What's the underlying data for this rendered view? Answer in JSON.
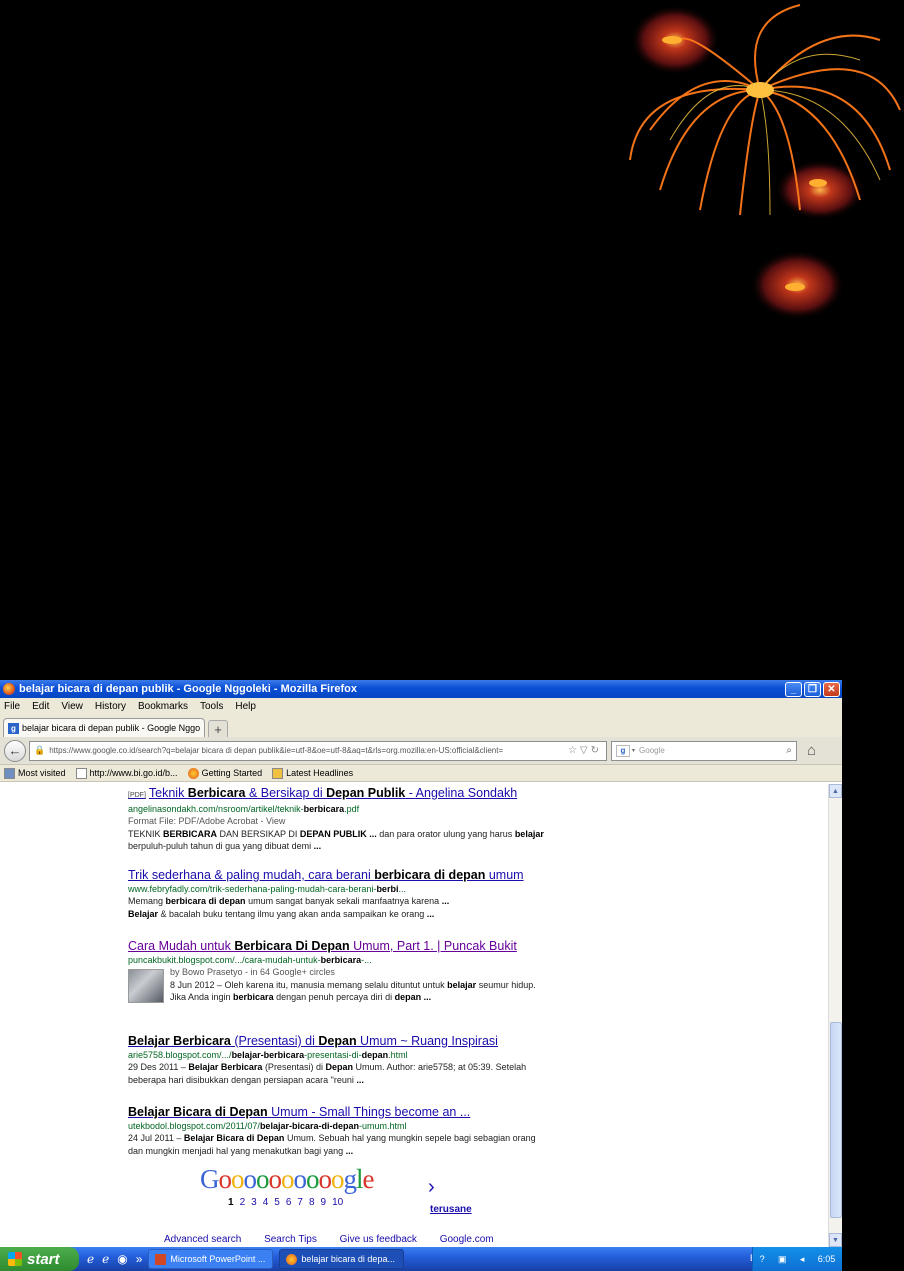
{
  "window": {
    "title": "belajar bicara di depan publik - Google Nggoleki - Mozilla Firefox"
  },
  "menu": [
    "File",
    "Edit",
    "View",
    "History",
    "Bookmarks",
    "Tools",
    "Help"
  ],
  "tab": {
    "label": "belajar bicara di depan publik - Google Nggol...",
    "new_tab": "+"
  },
  "nav": {
    "url": "https://www.google.co.id/search?q=belajar bicara di depan publik&ie=utf-8&oe=utf-8&aq=t&rls=org.mozilla:en-US:official&client=",
    "search_placeholder": "Google"
  },
  "bookmarks": [
    "Most visited",
    "http://www.bi.go.id/b...",
    "Getting Started",
    "Latest Headlines"
  ],
  "results": [
    {
      "pdf": "[PDF]",
      "title_html": "Teknik <b>Berbicara</b> &amp; Bersikap di <b>Depan Publik</b> - Angelina Sondakh",
      "url_html": "angelinasondakh.com/nsroom/artikel/teknik-<b>berbicara</b>.pdf",
      "meta": "Format File: PDF/Adobe Acrobat - View",
      "snippet_html": "TEKNIK <b>BERBICARA</b> DAN BERSIKAP DI <b>DEPAN PUBLIK ...</b> dan para orator ulung yang harus <b>belajar</b> berpuluh-puluh tahun di gua yang dibuat demi <b>...</b>"
    },
    {
      "title_html": "Trik sederhana &amp; paling mudah, cara berani <b>berbicara di depan</b> umum",
      "url_html": "www.febryfadly.com/trik-sederhana-paling-mudah-cara-berani-<b>berbi</b>...",
      "snippet_html": "Memang <b>berbicara di depan</b> umum sangat banyak sekali manfaatnya karena <b>...</b><br><b>Belajar</b> &amp; bacalah buku tentang ilmu yang akan anda sampaikan ke orang <b>...</b>"
    },
    {
      "title_html": "Cara Mudah untuk <b>Berbicara Di Depan</b> Umum, Part 1. | Puncak Bukit",
      "url_html": "puncakbukit.blogspot.com/.../cara-mudah-untuk-<b>berbicara</b>-...",
      "meta": "by Bowo Prasetyo - in 64 Google+ circles",
      "snippet_html": "8 Jun 2012 – Oleh karena itu, manusia memang selalu dituntut untuk <b>belajar</b> seumur hidup. Jika Anda ingin <b>berbicara</b> dengan penuh percaya diri di <b>depan ...</b>"
    },
    {
      "title_html": "<b>Belajar Berbicara</b> (Presentasi) di <b>Depan</b> Umum ~ Ruang Inspirasi",
      "url_html": "arie5758.blogspot.com/.../<b>belajar-berbicara</b>-presentasi-di-<b>depan</b>.html",
      "snippet_html": "29 Des 2011 – <b>Belajar Berbicara</b> (Presentasi) di <b>Depan</b> Umum. Author: arie5758; at 05:39. Setelah beberapa hari disibukkan dengan persiapan acara \"reuni <b>...</b>"
    },
    {
      "title_html": "<b>Belajar Bicara di Depan</b> Umum - Small Things become an ...",
      "url_html": "utekbodol.blogspot.com/2011/07/<b>belajar-bicara-di-depan</b>-umum.html",
      "snippet_html": "24 Jul 2011 – <b>Belajar Bicara di Depan</b> Umum. Sebuah hal yang mungkin sepele bagi sebagian orang dan mungkin menjadi hal yang menakutkan bagi yang <b>...</b>"
    }
  ],
  "pager": {
    "logo_letters": [
      "G",
      "o",
      "o",
      "o",
      "o",
      "o",
      "o",
      "o",
      "o",
      "o",
      "o",
      "g",
      "l",
      "e"
    ],
    "logo_colors": [
      "#3a63d6",
      "#d8362a",
      "#f2b20f",
      "#3a63d6",
      "#1a9b3a",
      "#d8362a",
      "#f2b20f",
      "#3a63d6",
      "#1a9b3a",
      "#d8362a",
      "#f2b20f",
      "#3a63d6",
      "#1a9b3a",
      "#d8362a"
    ],
    "pages": [
      "1",
      "2",
      "3",
      "4",
      "5",
      "6",
      "7",
      "8",
      "9",
      "10"
    ],
    "next_arrow": "›",
    "next_label": "terusane"
  },
  "footer_links": [
    "Advanced search",
    "Search Tips",
    "Give us feedback",
    "Google.com"
  ],
  "taskbar": {
    "start": "start",
    "quick_launch_more": "»",
    "items": [
      "Microsoft PowerPoint ...",
      "belajar bicara di depa..."
    ],
    "lang": "EN",
    "clock": "6:05"
  }
}
